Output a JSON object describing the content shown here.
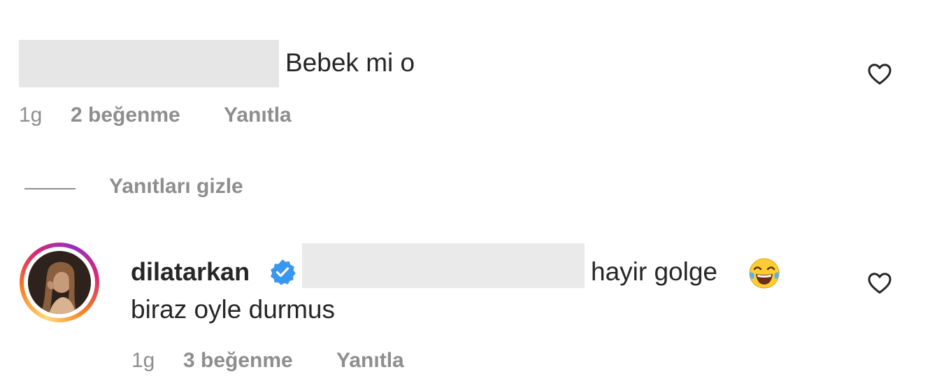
{
  "comments": [
    {
      "text": "Bebek mi o",
      "time": "1g",
      "likes": "2 beğenme",
      "reply_label": "Yanıtla"
    },
    {
      "username": "dilatarkan",
      "verified": true,
      "text_line1": "hayir golge",
      "emoji": "face-with-tears-of-joy",
      "text_line2": "biraz oyle durmus",
      "time": "1g",
      "likes": "3 beğenme",
      "reply_label": "Yanıtla"
    }
  ],
  "replies_toggle": {
    "label": "Yanıtları gizle"
  },
  "icons": {
    "like": "heart-outline-icon",
    "verified": "verified-badge-icon"
  },
  "colors": {
    "verified": "#3897f0",
    "meta_text": "#8e8e8e",
    "redaction": "#e6e6e6"
  }
}
